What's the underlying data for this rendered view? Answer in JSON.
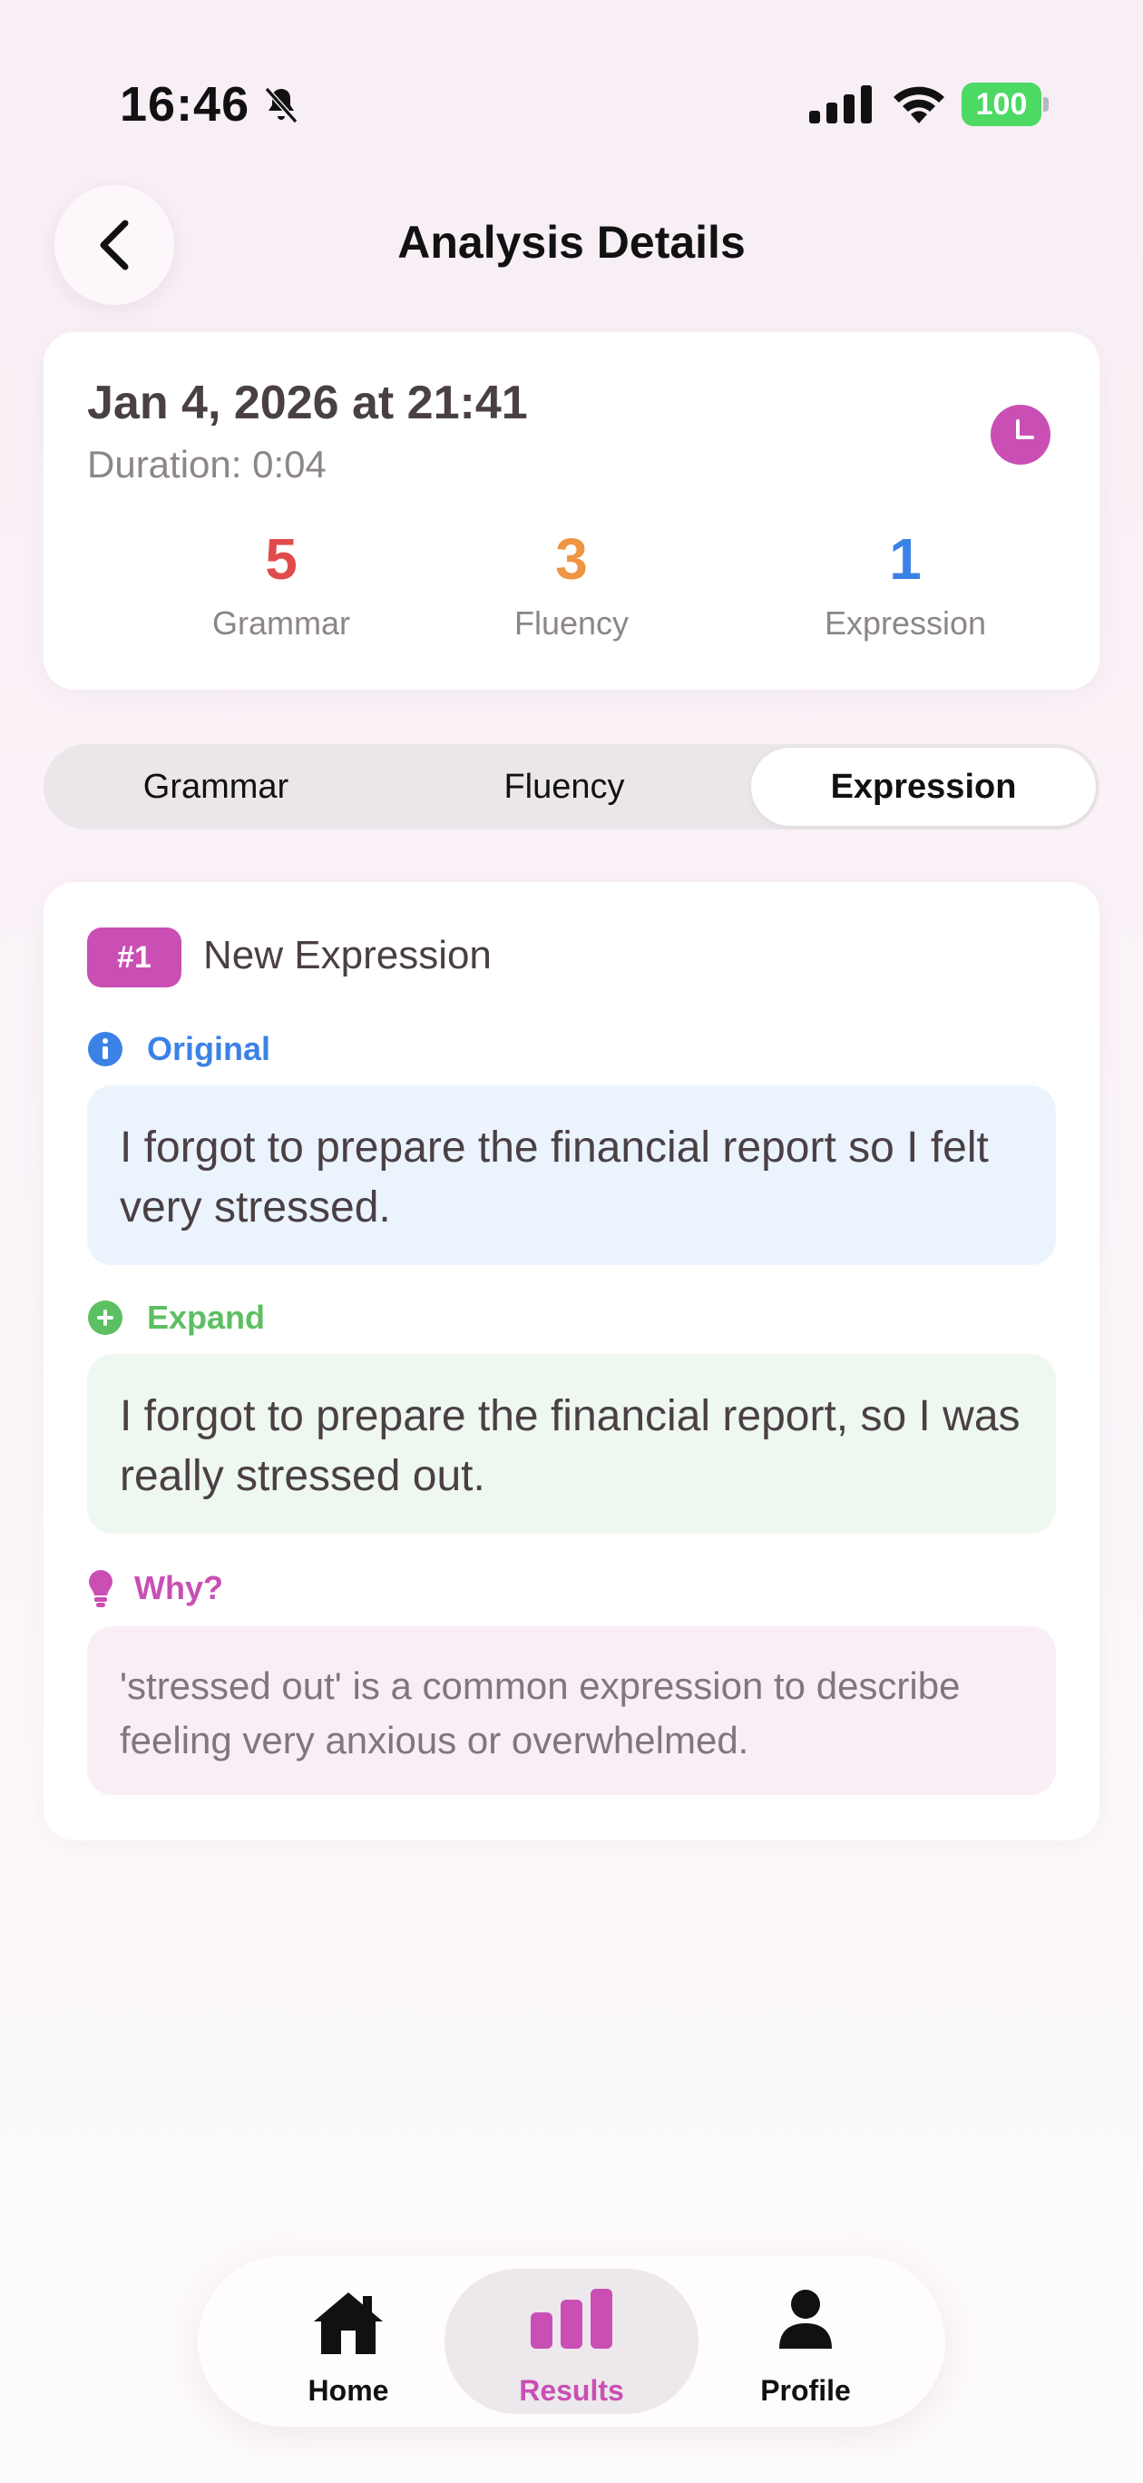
{
  "status": {
    "time": "16:46",
    "battery": "100"
  },
  "header": {
    "title": "Analysis Details"
  },
  "summary": {
    "date": "Jan 4, 2026 at 21:41",
    "duration": "Duration: 0:04",
    "stats": [
      {
        "value": "5",
        "label": "Grammar",
        "color": "#e04b4b"
      },
      {
        "value": "3",
        "label": "Fluency",
        "color": "#ef9443"
      },
      {
        "value": "1",
        "label": "Expression",
        "color": "#3b82e6"
      }
    ]
  },
  "tabs": {
    "items": [
      "Grammar",
      "Fluency",
      "Expression"
    ],
    "selected": "Expression"
  },
  "expression": {
    "badge": "#1",
    "title": "New Expression",
    "original_label": "Original",
    "original_text": "I forgot to prepare the financial report so I felt very stressed.",
    "expand_label": "Expand",
    "expand_text": "I forgot to prepare the financial report, so I was really stressed out.",
    "why_label": "Why?",
    "why_text": "'stressed out' is a common expression to describe feeling very anxious or overwhelmed."
  },
  "nav": {
    "home": "Home",
    "results": "Results",
    "profile": "Profile",
    "active": "Results"
  },
  "colors": {
    "accent": "#c94fb5",
    "blue": "#3b82e6",
    "green": "#5cbf62"
  }
}
